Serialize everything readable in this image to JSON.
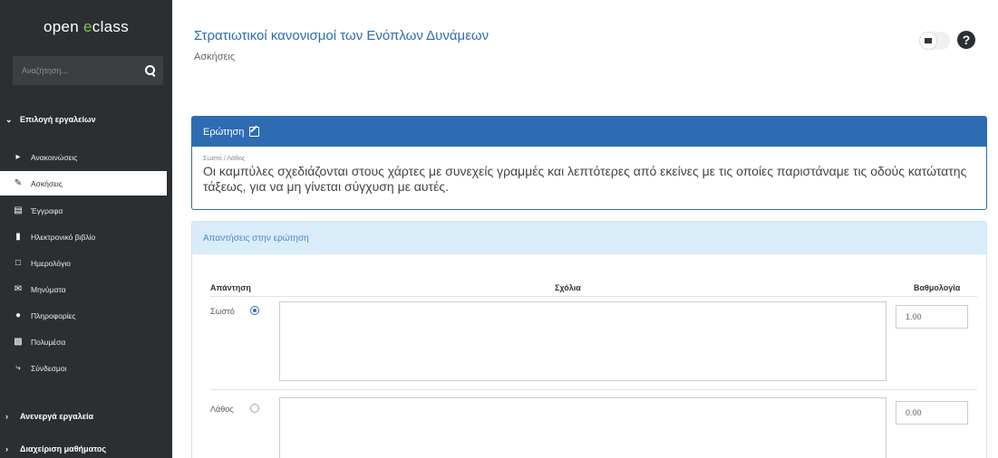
{
  "sidebar": {
    "logo_prefix": "open ",
    "logo_accent": "e",
    "logo_suffix": "class",
    "search_placeholder": "Αναζήτηση...",
    "groups": {
      "main": "Επιλογή εργαλείων",
      "inactive": "Ανενεργά εργαλεία",
      "manage": "Διαχείριση μαθήματος"
    },
    "items": [
      {
        "label": "Ανακοινώσεις",
        "icon": "announcements-icon"
      },
      {
        "label": "Ασκήσεις",
        "icon": "exercises-icon"
      },
      {
        "label": "Έγγραφα",
        "icon": "documents-icon"
      },
      {
        "label": "Ηλεκτρονικό βιβλίο",
        "icon": "ebook-icon"
      },
      {
        "label": "Ημερολόγιο",
        "icon": "calendar-icon"
      },
      {
        "label": "Μηνύματα",
        "icon": "messages-icon"
      },
      {
        "label": "Πληροφορίες",
        "icon": "info-icon"
      },
      {
        "label": "Πολυμέσα",
        "icon": "multimedia-icon"
      },
      {
        "label": "Σύνδεσμοι",
        "icon": "links-icon"
      }
    ]
  },
  "header": {
    "course_title": "Στρατιωτικοί κανονισμοί των Ενόπλων Δυνάμεων",
    "breadcrumb": "Ασκήσεις"
  },
  "question": {
    "heading": "Ερώτηση",
    "type": "Σωστό / Λάθος",
    "text": "Οι καμπύλες σχεδιάζονται στους χάρτες με συνεχείς γραμμές και λεπτότερες από εκείνες με τις οποίες παριστάναμε τις οδούς κατώτατης τάξεως, για να μη γίνεται σύγχυση με αυτές."
  },
  "answers": {
    "heading": "Απαντήσεις στην ερώτηση",
    "col_answer": "Απάντηση",
    "col_comments": "Σχόλια",
    "col_grade": "Βαθμολογία",
    "rows": [
      {
        "label": "Σωστό",
        "grade": "1.00"
      },
      {
        "label": "Λάθος",
        "grade": "0.00"
      }
    ]
  },
  "colors": {
    "sidebar_bg": "#2b2f32",
    "accent_blue": "#2d6cb3",
    "logo_accent": "#7fc243",
    "answers_header_bg": "#d9ecfa"
  }
}
